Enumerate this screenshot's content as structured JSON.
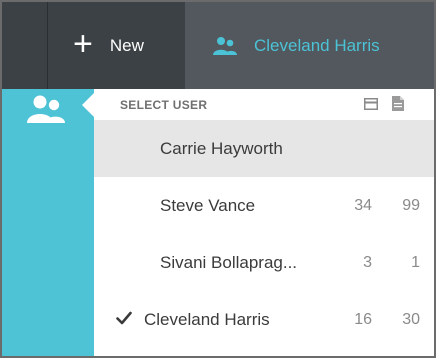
{
  "toolbar": {
    "new_label": "New",
    "current_user": "Cleveland Harris"
  },
  "panel": {
    "title": "SELECT USER"
  },
  "users": [
    {
      "name": "Carrie Hayworth",
      "count1": "",
      "count2": "",
      "selected": true,
      "current": false
    },
    {
      "name": "Steve Vance",
      "count1": "34",
      "count2": "99",
      "selected": false,
      "current": false
    },
    {
      "name": "Sivani Bollaprag...",
      "count1": "3",
      "count2": "1",
      "selected": false,
      "current": false
    },
    {
      "name": "Cleveland Harris",
      "count1": "16",
      "count2": "30",
      "selected": false,
      "current": true
    }
  ],
  "colors": {
    "toolbar_bg": "#3c4145",
    "tab_bg": "#52585d",
    "accent": "#4fc3d6",
    "selected_row": "#e6e6e6"
  },
  "icons": {
    "new": "plus-icon",
    "tab_user": "users-icon",
    "rail_user": "users-icon",
    "header_a": "card-icon",
    "header_b": "document-icon",
    "current_mark": "checkmark-icon"
  }
}
